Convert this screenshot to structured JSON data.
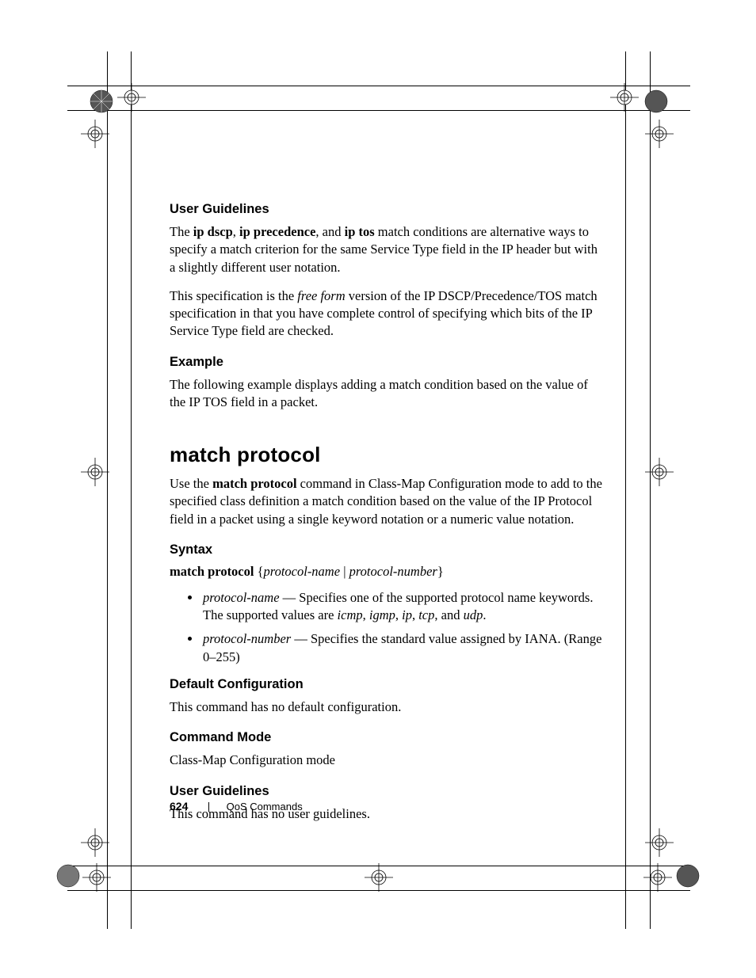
{
  "sections": {
    "userGuidelines1": {
      "heading": "User Guidelines",
      "p1_pre": "The ",
      "p1_b1": "ip dscp",
      "p1_mid1": ", ",
      "p1_b2": "ip precedence",
      "p1_mid2": ", and ",
      "p1_b3": "ip tos",
      "p1_post": " match conditions are alternative ways to specify a match criterion for the same Service Type field in the IP header but with a slightly different user notation.",
      "p2_pre": "This specification is the ",
      "p2_i": "free form",
      "p2_post": " version of the IP DSCP/Precedence/TOS match specification in that you have complete control of specifying which bits of the IP Service Type field are checked."
    },
    "example": {
      "heading": "Example",
      "p1": "The following example displays adding a match condition based on the value of the IP TOS field in a packet."
    },
    "matchProtocol": {
      "heading": "match protocol",
      "intro_pre": "Use the ",
      "intro_b": "match protocol",
      "intro_post": " command in Class-Map Configuration mode to add to the specified class definition a match condition based on the value of the IP Protocol field in a packet using a single keyword notation or a numeric value notation."
    },
    "syntax": {
      "heading": "Syntax",
      "line_b": "match protocol",
      "line_brace_open": " {",
      "line_i1": "protocol-name",
      "line_pipe": " | ",
      "line_i2": "protocol-number",
      "line_brace_close": "}",
      "bullet1_i": "protocol-name",
      "bullet1_mid": " — Specifies one of the supported protocol name keywords. The supported values are ",
      "bullet1_v1": "icmp",
      "bullet1_c1": ", ",
      "bullet1_v2": "igmp",
      "bullet1_c2": ", ",
      "bullet1_v3": "ip",
      "bullet1_c3": ", ",
      "bullet1_v4": "tcp",
      "bullet1_c4": ", and ",
      "bullet1_v5": "udp",
      "bullet1_end": ".",
      "bullet2_i": "protocol-number",
      "bullet2_post": " — Specifies the standard value assigned by IANA. (Range 0–255)"
    },
    "defaultConfig": {
      "heading": "Default Configuration",
      "p1": "This command has no default configuration."
    },
    "commandMode": {
      "heading": "Command Mode",
      "p1": "Class-Map Configuration mode"
    },
    "userGuidelines2": {
      "heading": "User Guidelines",
      "p1": "This command has no user guidelines."
    }
  },
  "footer": {
    "pageNumber": "624",
    "section": "QoS Commands"
  }
}
